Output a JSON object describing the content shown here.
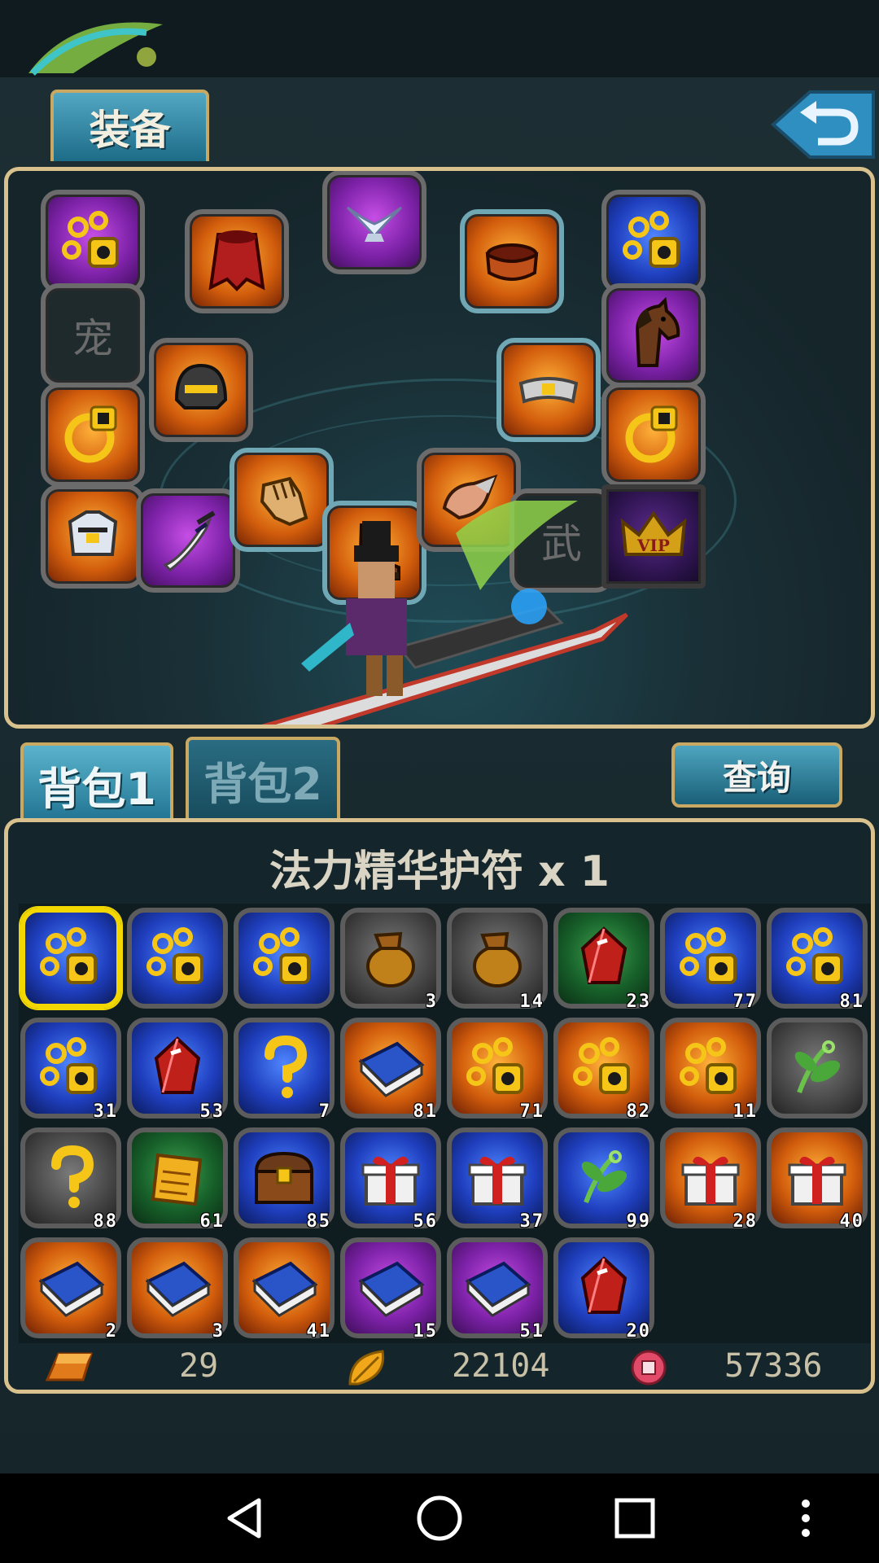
{
  "equip_tab": "装备",
  "equip_slots": [
    {
      "id": "necklace-1",
      "icon": "necklace-icon",
      "bg": "purple"
    },
    {
      "id": "cape",
      "icon": "cape-icon",
      "bg": "orange"
    },
    {
      "id": "wings",
      "icon": "wings-icon",
      "bg": "purple"
    },
    {
      "id": "bracelet",
      "icon": "bracelet-icon",
      "bg": "orange"
    },
    {
      "id": "necklace-2",
      "icon": "necklace-icon",
      "bg": "blue"
    },
    {
      "id": "pet",
      "icon": "pet-slot-icon",
      "bg": "dark",
      "label": "宠"
    },
    {
      "id": "helmet",
      "icon": "helmet-icon",
      "bg": "orange"
    },
    {
      "id": "mount",
      "icon": "horse-icon",
      "bg": "purple"
    },
    {
      "id": "ring-1",
      "icon": "ring-icon",
      "bg": "orange"
    },
    {
      "id": "belt",
      "icon": "belt-icon",
      "bg": "orange"
    },
    {
      "id": "ring-2",
      "icon": "ring-icon",
      "bg": "orange"
    },
    {
      "id": "armor",
      "icon": "armor-icon",
      "bg": "orange"
    },
    {
      "id": "weapon",
      "icon": "sword-icon",
      "bg": "purple"
    },
    {
      "id": "gloves",
      "icon": "gloves-icon",
      "bg": "orange"
    },
    {
      "id": "boots",
      "icon": "boots-icon",
      "bg": "orange"
    },
    {
      "id": "shoulder",
      "icon": "shoulder-icon",
      "bg": "orange"
    },
    {
      "id": "weapon-slot",
      "icon": "weapon-slot-icon",
      "bg": "dark",
      "label": "武"
    },
    {
      "id": "vip",
      "icon": "vip-crown-icon",
      "bg": "vip",
      "label": "VIP"
    }
  ],
  "bag_tabs": [
    "背包1",
    "背包2"
  ],
  "query_button": "查询",
  "selected_item": "法力精华护符 x 1",
  "inventory": [
    {
      "icon": "necklace-icon",
      "bg": "blue",
      "count": ""
    },
    {
      "icon": "necklace-icon",
      "bg": "blue",
      "count": ""
    },
    {
      "icon": "necklace-icon",
      "bg": "blue",
      "count": ""
    },
    {
      "icon": "pouch-icon",
      "bg": "gray",
      "count": "3"
    },
    {
      "icon": "pouch-icon",
      "bg": "gray",
      "count": "14"
    },
    {
      "icon": "red-gem-icon",
      "bg": "green",
      "count": "23"
    },
    {
      "icon": "necklace-icon",
      "bg": "blue",
      "count": "77"
    },
    {
      "icon": "necklace-icon",
      "bg": "blue",
      "count": "81"
    },
    {
      "icon": "necklace-icon",
      "bg": "blue",
      "count": "31"
    },
    {
      "icon": "red-gem-icon",
      "bg": "blue",
      "count": "53"
    },
    {
      "icon": "question-icon",
      "bg": "blue",
      "count": "7"
    },
    {
      "icon": "book-icon",
      "bg": "orange",
      "count": "81"
    },
    {
      "icon": "necklace-icon",
      "bg": "orange",
      "count": "71"
    },
    {
      "icon": "necklace-icon",
      "bg": "orange",
      "count": "82"
    },
    {
      "icon": "necklace-icon",
      "bg": "orange",
      "count": "11"
    },
    {
      "icon": "herb-icon",
      "bg": "gray",
      "count": ""
    },
    {
      "icon": "question-icon",
      "bg": "gray",
      "count": "88"
    },
    {
      "icon": "scroll-icon",
      "bg": "green",
      "count": "61"
    },
    {
      "icon": "chest-icon",
      "bg": "blue",
      "count": "85"
    },
    {
      "icon": "gift-icon",
      "bg": "blue",
      "count": "56"
    },
    {
      "icon": "gift-icon",
      "bg": "blue",
      "count": "37"
    },
    {
      "icon": "herb-icon",
      "bg": "blue",
      "count": "99"
    },
    {
      "icon": "gift-icon",
      "bg": "orange",
      "count": "28"
    },
    {
      "icon": "gift-icon",
      "bg": "orange",
      "count": "40"
    },
    {
      "icon": "book-icon",
      "bg": "orange",
      "count": "2"
    },
    {
      "icon": "book-icon",
      "bg": "orange",
      "count": "3"
    },
    {
      "icon": "book-icon",
      "bg": "orange",
      "count": "41"
    },
    {
      "icon": "book-icon",
      "bg": "purple",
      "count": "15"
    },
    {
      "icon": "book-icon",
      "bg": "purple",
      "count": "51"
    },
    {
      "icon": "red-gem-icon",
      "bg": "blue",
      "count": "20"
    }
  ],
  "currency": {
    "gold": "29",
    "leaf": "22104",
    "coin": "57336"
  },
  "colors": {
    "gold_border": "#d8c18c",
    "selected": "#f2d800",
    "tab_blue": "#1f7290"
  }
}
